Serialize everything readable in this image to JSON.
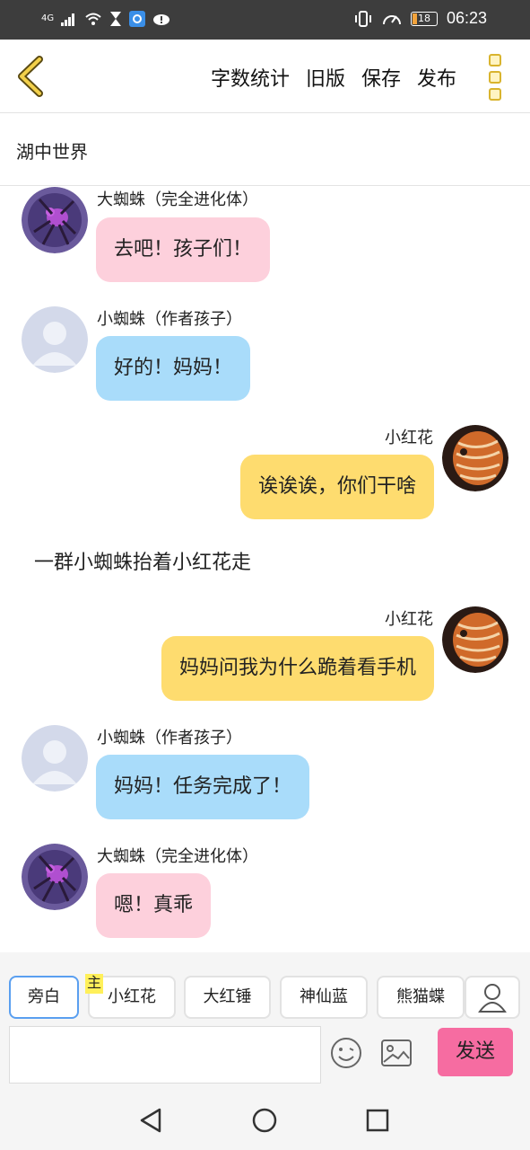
{
  "status_bar": {
    "network": "4G",
    "battery": "18",
    "time": "06:23"
  },
  "header": {
    "back_icon": "chevron-left-icon",
    "actions": [
      {
        "label": "字数统计"
      },
      {
        "label": "旧版"
      },
      {
        "label": "保存"
      },
      {
        "label": "发布"
      }
    ],
    "more_icon": "more-vertical-icon"
  },
  "title": "湖中世界",
  "messages": [
    {
      "role": "left",
      "sender": "大蜘蛛（完全进化体）",
      "text": "去吧！孩子们！",
      "color": "#fdd0dc",
      "avatar": "spider-avatar"
    },
    {
      "role": "left",
      "sender": "小蜘蛛（作者孩子）",
      "text": "好的！妈妈！",
      "color": "#a9dcfa",
      "avatar": "default-avatar"
    },
    {
      "role": "right",
      "sender": "小红花",
      "text": "诶诶诶，你们干啥",
      "color": "#fedc6f",
      "avatar": "fish-avatar"
    },
    {
      "role": "narration",
      "text": "一群小蜘蛛抬着小红花走"
    },
    {
      "role": "right",
      "sender": "小红花",
      "text": "妈妈问我为什么跪着看手机",
      "color": "#fedc6f",
      "avatar": "fish-avatar"
    },
    {
      "role": "left",
      "sender": "小蜘蛛（作者孩子）",
      "text": "妈妈！任务完成了！",
      "color": "#a9dcfa",
      "avatar": "default-avatar"
    },
    {
      "role": "left",
      "sender": "大蜘蛛（完全进化体）",
      "text": "嗯！真乖",
      "color": "#fdd0dc",
      "avatar": "spider-avatar"
    }
  ],
  "roles": {
    "chips": [
      {
        "label": "旁白",
        "selected": true
      },
      {
        "label": "小红花",
        "badge": "主"
      },
      {
        "label": "大红锤"
      },
      {
        "label": "神仙蓝"
      },
      {
        "label": "熊猫蝶"
      }
    ],
    "person_icon": "person-icon"
  },
  "composer": {
    "value": "",
    "emoji_icon": "emoji-icon",
    "image_icon": "image-icon",
    "send_label": "发送"
  },
  "navigation": {
    "back": "back-triangle-icon",
    "home": "home-circle-icon",
    "recents": "recents-square-icon"
  }
}
